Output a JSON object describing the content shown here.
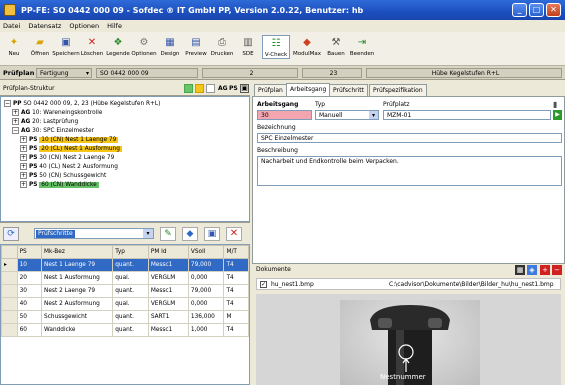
{
  "window": {
    "title": "PP-FE: SO 0442 000 09 - Sofdec ® IT GmbH PP, Version 2.0.22, Benutzer: hb"
  },
  "menu": [
    "Datei",
    "Datensatz",
    "Optionen",
    "Hilfe"
  ],
  "toolbar": [
    {
      "label": "Neu",
      "icon": "new-icon"
    },
    {
      "label": "Öffnen",
      "icon": "open-icon"
    },
    {
      "label": "Speichern",
      "icon": "save-icon"
    },
    {
      "label": "Löschen",
      "icon": "delete-icon"
    },
    {
      "label": "Legende",
      "icon": "legend-icon"
    },
    {
      "label": "Optionen",
      "icon": "options-icon"
    },
    {
      "label": "Design",
      "icon": "design-icon"
    },
    {
      "label": "Preview",
      "icon": "preview-icon"
    },
    {
      "label": "Drucken",
      "icon": "print-icon"
    },
    {
      "label": "SDE",
      "icon": "sde-icon"
    },
    {
      "label": "V-Check",
      "icon": "vcheck-icon"
    },
    {
      "label": "ModulMax",
      "icon": "modulmax-icon"
    },
    {
      "label": "Bauen",
      "icon": "build-icon"
    },
    {
      "label": "Beenden",
      "icon": "exit-icon"
    }
  ],
  "infobar": {
    "label": "Prüfplan",
    "type": "Fertigung",
    "number": "SO 0442 000 09",
    "version": "2",
    "revision": "23",
    "company": "Hübe Kegelstufen R+L"
  },
  "tree": {
    "header": "Prüfplan-Struktur",
    "ag_label": "AG",
    "ps_label": "PS",
    "rows": [
      {
        "tag": "PP",
        "text": "SO 0442 000 09, 2, 23 (Hübe Kegelstufen R+L)",
        "level": 0,
        "hl": ""
      },
      {
        "tag": "AG",
        "text": "10: Wareneingskontrolle",
        "level": 1,
        "hl": ""
      },
      {
        "tag": "AG",
        "text": "20: Lastprüfung",
        "level": 1,
        "hl": ""
      },
      {
        "tag": "AG",
        "text": "30: SPC Einzelmester",
        "level": 1,
        "hl": ""
      },
      {
        "tag": "PS",
        "text": "10 (CN) Nest 1 Laenge 79",
        "level": 2,
        "hl": "#f5c518"
      },
      {
        "tag": "PS",
        "text": "20 (CL) Nest 1 Ausformung",
        "level": 2,
        "hl": "#f5c518"
      },
      {
        "tag": "PS",
        "text": "30 (CN) Nest 2 Laenge 79",
        "level": 2,
        "hl": ""
      },
      {
        "tag": "PS",
        "text": "40 (CL) Nest 2 Ausformung",
        "level": 2,
        "hl": ""
      },
      {
        "tag": "PS",
        "text": "50 (CN) Schussgewicht",
        "level": 2,
        "hl": ""
      },
      {
        "tag": "PS",
        "text": "60 (CN) Wanddicke",
        "level": 2,
        "hl": "#66c266"
      }
    ]
  },
  "table": {
    "filter": "Prüfschritte",
    "headers": [
      "PS",
      "Mk-Bez",
      "Typ",
      "PM Id",
      "VSoll",
      "M/T"
    ],
    "rows": [
      [
        "10",
        "Nest 1 Laenge 79",
        "quant.",
        "Messc1",
        "79,000",
        "T4"
      ],
      [
        "20",
        "Nest 1 Ausformung",
        "qual.",
        "VERGLM",
        "0,000",
        "T4"
      ],
      [
        "30",
        "Nest 2 Laenge 79",
        "quant.",
        "Messc1",
        "79,000",
        "T4"
      ],
      [
        "40",
        "Nest 2 Ausformung",
        "qual.",
        "VERGLM",
        "0,000",
        "T4"
      ],
      [
        "50",
        "Schussgewicht",
        "quant.",
        "SART1",
        "136,000",
        "M"
      ],
      [
        "60",
        "Wanddicke",
        "quant.",
        "Messc1",
        "1,000",
        "T4"
      ]
    ]
  },
  "detail": {
    "tabs": [
      "Prüfplan",
      "Arbeitsgang",
      "Prüfschritt",
      "Prüfspezifikation"
    ],
    "ag_label": "Arbeitsgang",
    "ag_value": "30",
    "typ_label": "Typ",
    "typ_value": "Manuell",
    "pp_label": "Prüfplatz",
    "pp_value": "MZM-01",
    "bez_label": "Bezeichnung",
    "bez_value": "SPC Einzelmester",
    "desc_label": "Beschreibung",
    "desc_value": "Nacharbeit und Endkontrolle beim Verpacken."
  },
  "documents": {
    "label": "Dokumente",
    "file": "hu_nest1.bmp",
    "path": "C:\\cadvisor\\Dokumente\\Bilder\\Bilder_hu\\hu_nest1.bmp",
    "caption": "Nestnummer"
  }
}
